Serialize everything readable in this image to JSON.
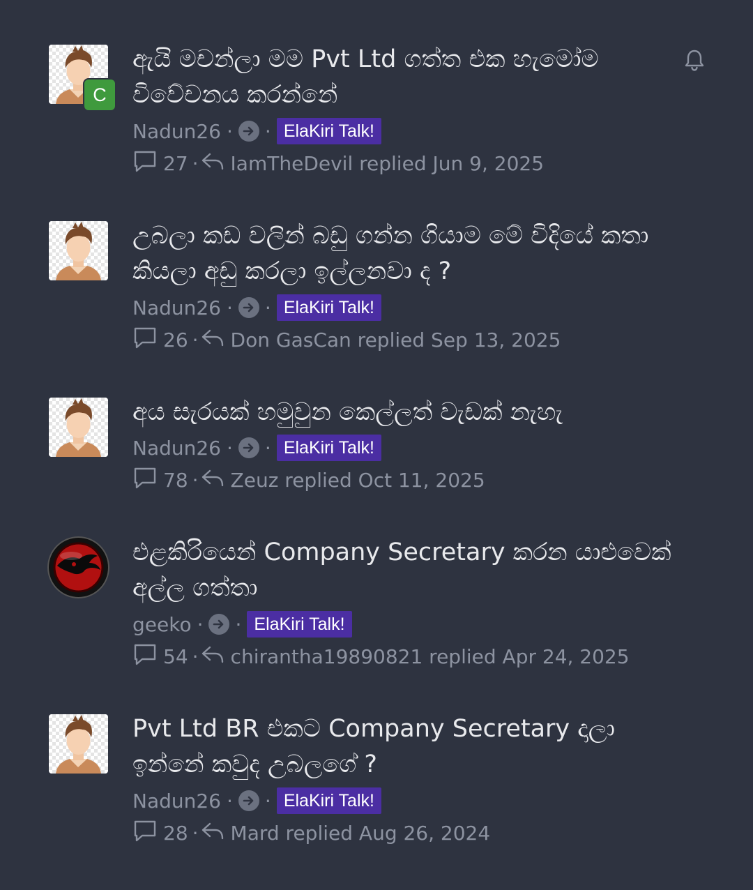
{
  "threads": [
    {
      "title": "ඇයි මචන්ලා මම Pvt Ltd ගත්ත එක හැමෝම විවේචනය කරන්නේ",
      "author": "Nadun26",
      "forum": "ElaKiri Talk!",
      "replies": "27",
      "last_reply": "IamTheDevil replied Jun 9, 2025",
      "avatar_badge": "C",
      "icons": [
        "default-avatar-icon",
        "arrow-right-circle-icon",
        "comment-icon",
        "reply-icon",
        "bell-icon"
      ]
    },
    {
      "title": "උබලා කඩ වලින් බඩු ගන්න ගියාම මේ විදියේ කතා කියලා අඩු කරලා ඉල්ලනවා ද ?",
      "author": "Nadun26",
      "forum": "ElaKiri Talk!",
      "replies": "26",
      "last_reply": "Don GasCan replied Sep 13, 2025"
    },
    {
      "title": "අය සැරයක් හමුවුන කෙල්ලත් වැඩක් නැහැ",
      "author": "Nadun26",
      "forum": "ElaKiri Talk!",
      "replies": "78",
      "last_reply": "Zeuz replied Oct 11, 2025"
    },
    {
      "title": "එළකිරියෙන් Company Secretary කරන යාළුවෙක් අල්ල ගත්තා",
      "author": "geeko",
      "forum": "ElaKiri Talk!",
      "replies": "54",
      "last_reply": "chirantha19890821 replied Apr 24, 2025"
    },
    {
      "title": "Pvt Ltd BR එකට Company Secretary දාලා ඉන්නේ කවුද උබලගේ ?",
      "author": "Nadun26",
      "forum": "ElaKiri Talk!",
      "replies": "28",
      "last_reply": "Mard replied Aug 26, 2024"
    }
  ],
  "colors": {
    "background": "#2e3340",
    "forum_tag": "#4b2ea3",
    "badge_c": "#3f9a3d",
    "muted_text": "#8d93a1"
  }
}
